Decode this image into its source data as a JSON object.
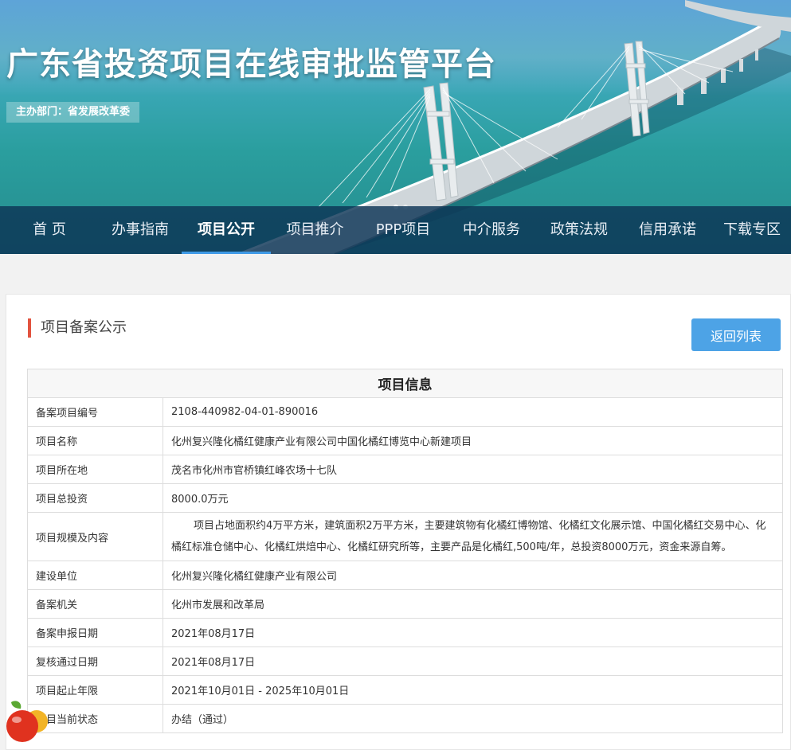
{
  "banner": {
    "title": "广东省投资项目在线审批监管平台",
    "sponsor": "主办部门：省发展改革委"
  },
  "nav": {
    "items": [
      {
        "label": "首 页",
        "active": false
      },
      {
        "label": "办事指南",
        "active": false
      },
      {
        "label": "项目公开",
        "active": true
      },
      {
        "label": "项目推介",
        "active": false
      },
      {
        "label": "PPP项目",
        "active": false
      },
      {
        "label": "中介服务",
        "active": false
      },
      {
        "label": "政策法规",
        "active": false
      },
      {
        "label": "信用承诺",
        "active": false
      },
      {
        "label": "下载专区",
        "active": false
      }
    ]
  },
  "main": {
    "section_title": "项目备案公示",
    "back_button": "返回列表",
    "table_header": "项目信息",
    "rows": [
      {
        "key": "备案项目编号",
        "value": "2108-440982-04-01-890016"
      },
      {
        "key": "项目名称",
        "value": "化州复兴隆化橘红健康产业有限公司中国化橘红博览中心新建项目"
      },
      {
        "key": "项目所在地",
        "value": "茂名市化州市官桥镇红峰农场十七队"
      },
      {
        "key": "项目总投资",
        "value": "8000.0万元"
      },
      {
        "key": "项目规模及内容",
        "value": "项目占地面积约4万平方米，建筑面积2万平方米，主要建筑物有化橘红博物馆、化橘红文化展示馆、中国化橘红交易中心、化橘红标准仓储中心、化橘红烘焙中心、化橘红研究所等，主要产品是化橘红,500吨/年，总投资8000万元，资金来源自筹。"
      },
      {
        "key": "建设单位",
        "value": "化州复兴隆化橘红健康产业有限公司"
      },
      {
        "key": "备案机关",
        "value": "化州市发展和改革局"
      },
      {
        "key": "备案申报日期",
        "value": "2021年08月17日"
      },
      {
        "key": "复核通过日期",
        "value": "2021年08月17日"
      },
      {
        "key": "项目起止年限",
        "value": "2021年10月01日 - 2025年10月01日"
      },
      {
        "key": "项目当前状态",
        "value": "办结（通过）"
      }
    ]
  },
  "colors": {
    "nav_bg": "#0c3456",
    "accent": "#4da3e6",
    "section_marker": "#e2533f"
  }
}
